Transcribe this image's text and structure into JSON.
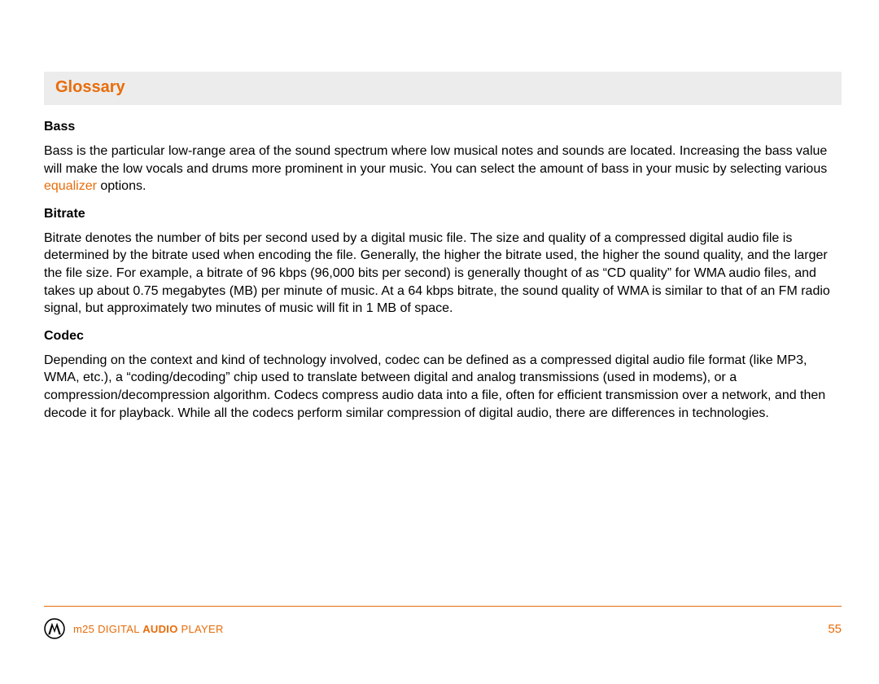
{
  "section_title": "Glossary",
  "entries": [
    {
      "term": "Bass",
      "definition_pre": "Bass is the particular low-range area of the sound spectrum where low musical notes and sounds are located. Increasing the bass value will make the low vocals and drums more prominent in your music. You can select the amount of bass in your music by selecting various ",
      "link": "equalizer",
      "definition_post": " options."
    },
    {
      "term": "Bitrate",
      "definition_pre": "Bitrate denotes the number of bits per second used by a digital music file. The size and quality of a compressed digital audio file is determined by the bitrate used when encoding the file. Generally, the higher the bitrate used, the higher the sound quality, and the larger the file size. For example, a bitrate of 96 kbps (96,000 bits per second) is generally thought of as “CD quality” for WMA audio files, and takes up about 0.75 megabytes (MB) per minute of music. At a 64 kbps bitrate, the sound quality of WMA is similar to that of an FM radio signal, but approximately two minutes of music will fit in 1 MB of space.",
      "link": "",
      "definition_post": ""
    },
    {
      "term": "Codec",
      "definition_pre": "Depending on the context and kind of technology involved, codec can be defined as a compressed digital audio file format (like MP3, WMA, etc.), a “coding/decoding” chip used to translate between digital and analog transmissions (used in modems), or a compression/decompression algorithm. Codecs compress audio data into a file, often for efficient transmission over a network, and then decode it for playback. While all the codecs perform similar compression of digital audio, there are differences in technologies.",
      "link": "",
      "definition_post": ""
    }
  ],
  "footer": {
    "text_1": "m25 DIGITAL ",
    "text_bold": "AUDIO",
    "text_2": " PLAYER",
    "page_number": "55"
  }
}
